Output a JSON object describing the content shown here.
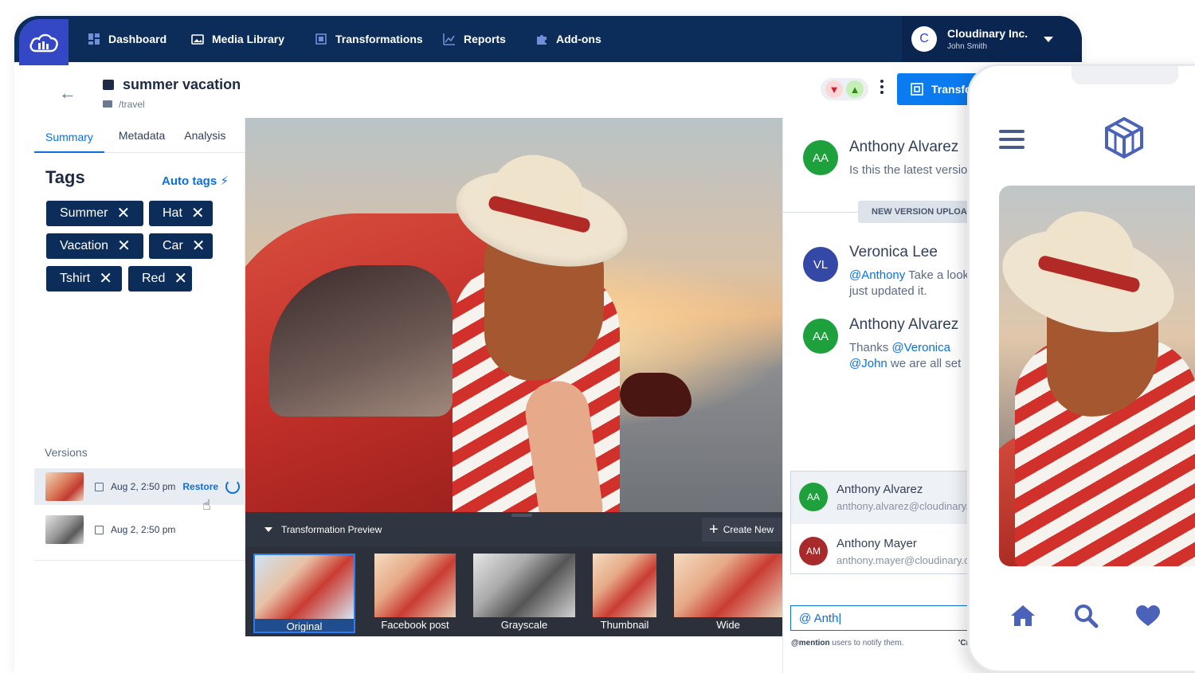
{
  "nav": {
    "items": [
      {
        "label": "Dashboard",
        "icon": "dashboard-icon"
      },
      {
        "label": "Media Library",
        "icon": "media-library-icon"
      },
      {
        "label": "Transformations",
        "icon": "transformations-icon"
      },
      {
        "label": "Reports",
        "icon": "reports-icon"
      },
      {
        "label": "Add-ons",
        "icon": "puzzle-icon"
      }
    ],
    "account": {
      "avatar_letter": "C",
      "company": "Cloudinary Inc.",
      "user": "John Smith"
    }
  },
  "asset": {
    "title": "summer vacation",
    "path": "/travel"
  },
  "header": {
    "transform_label": "Transform"
  },
  "left_panel": {
    "tabs": [
      "Summary",
      "Metadata",
      "Analysis"
    ],
    "active_tab": "Summary",
    "tags_title": "Tags",
    "auto_tags_label": "Auto tags",
    "tags": [
      "Summer",
      "Hat",
      "Vacation",
      "Car",
      "Tshirt",
      "Red"
    ],
    "versions_label": "Versions",
    "versions": [
      {
        "date": "Aug 2, 2:50 pm",
        "action": "Restore"
      },
      {
        "date": "Aug 2, 2:50 pm"
      }
    ]
  },
  "preview": {
    "title": "Transformation Preview",
    "create_new": "Create New",
    "thumbs": [
      "Original",
      "Facebook post",
      "Grayscale",
      "Thumbnail",
      "Wide"
    ],
    "selected": "Original"
  },
  "comments": {
    "items": [
      {
        "initials": "AA",
        "name": "Anthony Alvarez",
        "text": "Is this the latest version?"
      },
      {
        "initials": "VL",
        "name": "Veronica Lee",
        "mention": "@Anthony",
        "text": " Take a look,",
        "text2": "just updated it."
      },
      {
        "initials": "AA",
        "name": "Anthony Alvarez",
        "text": "Thanks ",
        "mention": "@Veronica",
        "mention2": "@John",
        "text2": " we are all set"
      }
    ],
    "version_badge": "NEW VERSION UPLOADED",
    "suggestions": [
      {
        "initials": "AA",
        "name": "Anthony Alvarez",
        "email": "anthony.alvarez@cloudinary.com"
      },
      {
        "initials": "AM",
        "name": "Anthony Mayer",
        "email": "anthony.mayer@cloudinary.com"
      }
    ],
    "input_value": "@ Anth|",
    "hint_bold": "@mention",
    "hint_text": " users to notify them.",
    "hint_cmd": "'Cmd"
  },
  "colors": {
    "nav_bg": "#0c2c5a",
    "accent": "#0b6fe0",
    "tag_bg": "#0c2c5a",
    "avatar_green": "#1ea03c",
    "avatar_blue": "#3448a5",
    "avatar_red": "#a92a2a"
  }
}
